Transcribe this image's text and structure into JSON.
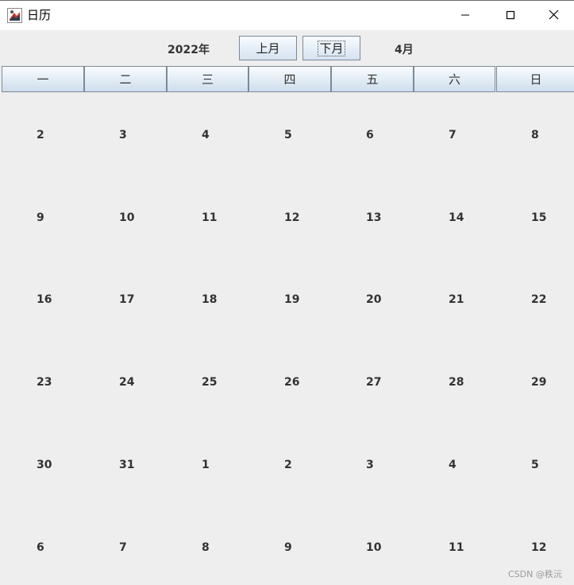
{
  "window": {
    "title": "日历",
    "icon": "java-cup-icon"
  },
  "header": {
    "year": "2022年",
    "prev_button": "上月",
    "next_button": "下月",
    "month": "4月"
  },
  "weekdays": [
    "一",
    "二",
    "三",
    "四",
    "五",
    "六",
    "日"
  ],
  "weeks": [
    [
      "2",
      "3",
      "4",
      "5",
      "6",
      "7",
      "8"
    ],
    [
      "9",
      "10",
      "11",
      "12",
      "13",
      "14",
      "15"
    ],
    [
      "16",
      "17",
      "18",
      "19",
      "20",
      "21",
      "22"
    ],
    [
      "23",
      "24",
      "25",
      "26",
      "27",
      "28",
      "29"
    ],
    [
      "30",
      "31",
      "1",
      "2",
      "3",
      "4",
      "5"
    ],
    [
      "6",
      "7",
      "8",
      "9",
      "10",
      "11",
      "12"
    ]
  ],
  "watermark": "CSDN @秩沅",
  "colors": {
    "background": "#eeeeee",
    "button_border": "#7a8a99",
    "text": "#333333"
  }
}
